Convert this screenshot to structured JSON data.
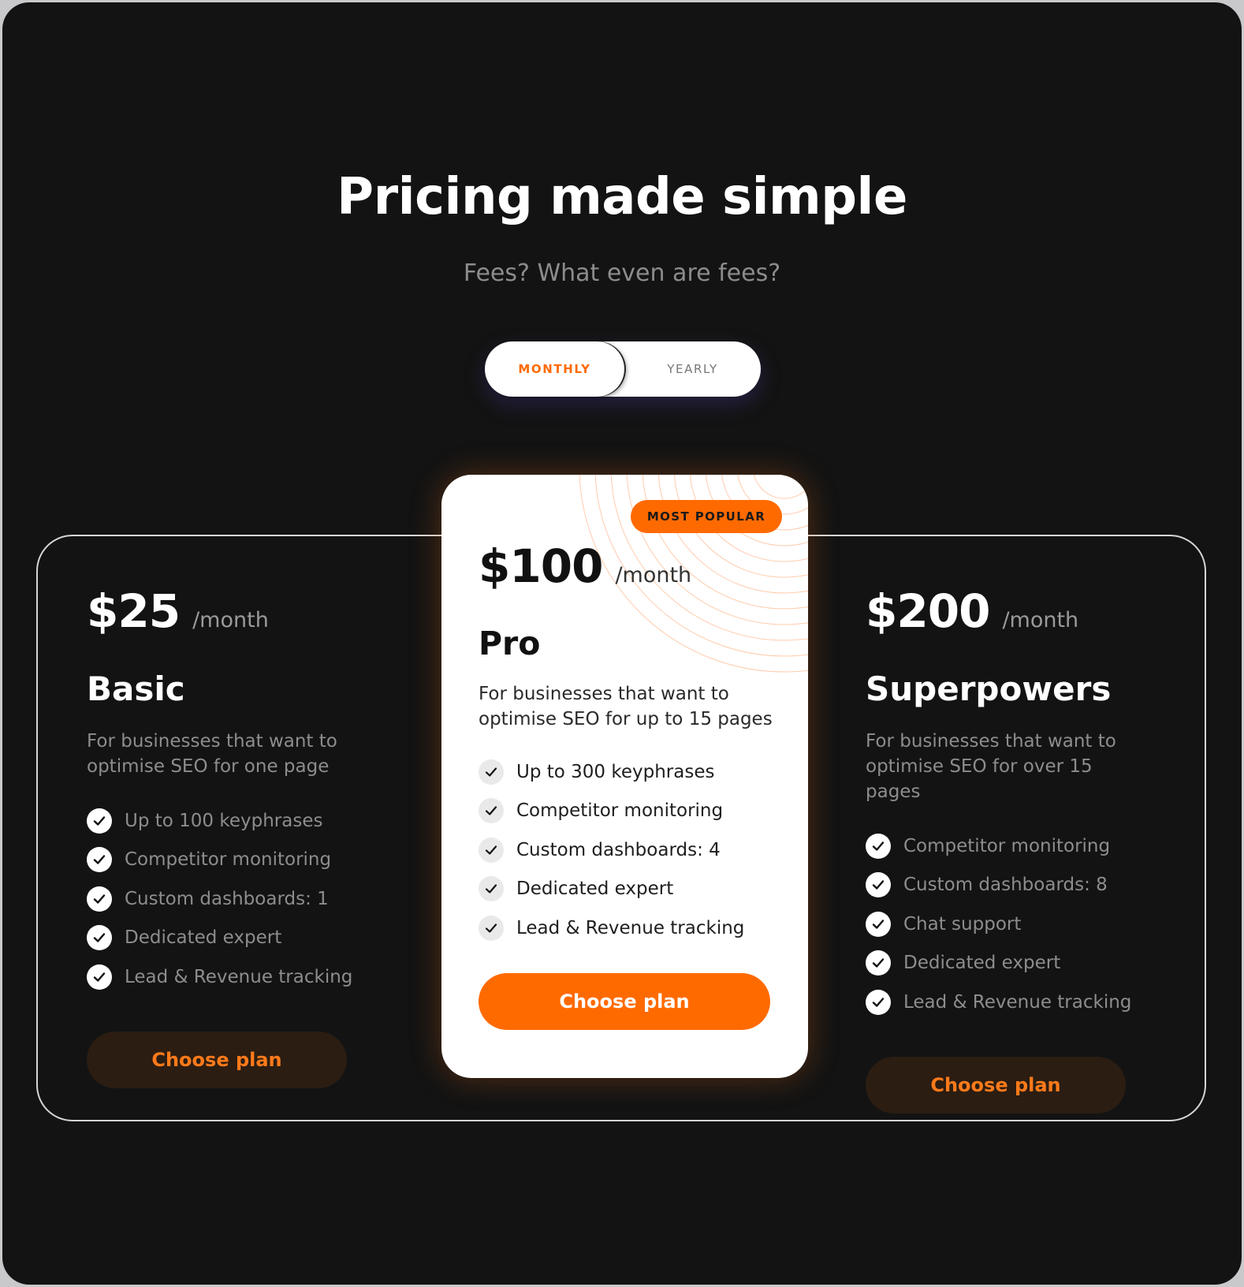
{
  "header": {
    "title": "Pricing made simple",
    "subtitle": "Fees? What even are fees?"
  },
  "billing_toggle": {
    "options": [
      "MONTHLY",
      "YEARLY"
    ],
    "selected": "MONTHLY"
  },
  "plans": [
    {
      "price": "$25",
      "period": "/month",
      "name": "Basic",
      "description": "For businesses that want to optimise SEO for one page",
      "features": [
        "Up to 100 keyphrases",
        "Competitor monitoring",
        "Custom dashboards: 1",
        "Dedicated expert",
        "Lead & Revenue tracking"
      ],
      "cta": "Choose plan"
    },
    {
      "badge": "MOST POPULAR",
      "price": "$100",
      "period": "/month",
      "name": "Pro",
      "description": "For businesses that want to optimise SEO for up to 15 pages",
      "features": [
        "Up to 300 keyphrases",
        "Competitor monitoring",
        "Custom dashboards: 4",
        "Dedicated expert",
        "Lead & Revenue tracking"
      ],
      "cta": "Choose plan"
    },
    {
      "price": "$200",
      "period": "/month",
      "name": "Superpowers",
      "description": "For businesses that want to optimise SEO for over 15 pages",
      "features": [
        "Competitor monitoring",
        "Custom dashboards: 8",
        "Chat support",
        "Dedicated expert",
        "Lead & Revenue tracking"
      ],
      "cta": "Choose plan"
    }
  ],
  "colors": {
    "background": "#131313",
    "accent": "#ff6a00",
    "dark_button": "#2b1d12",
    "card_light": "#ffffff"
  },
  "icons": {
    "feature": "check-icon"
  }
}
